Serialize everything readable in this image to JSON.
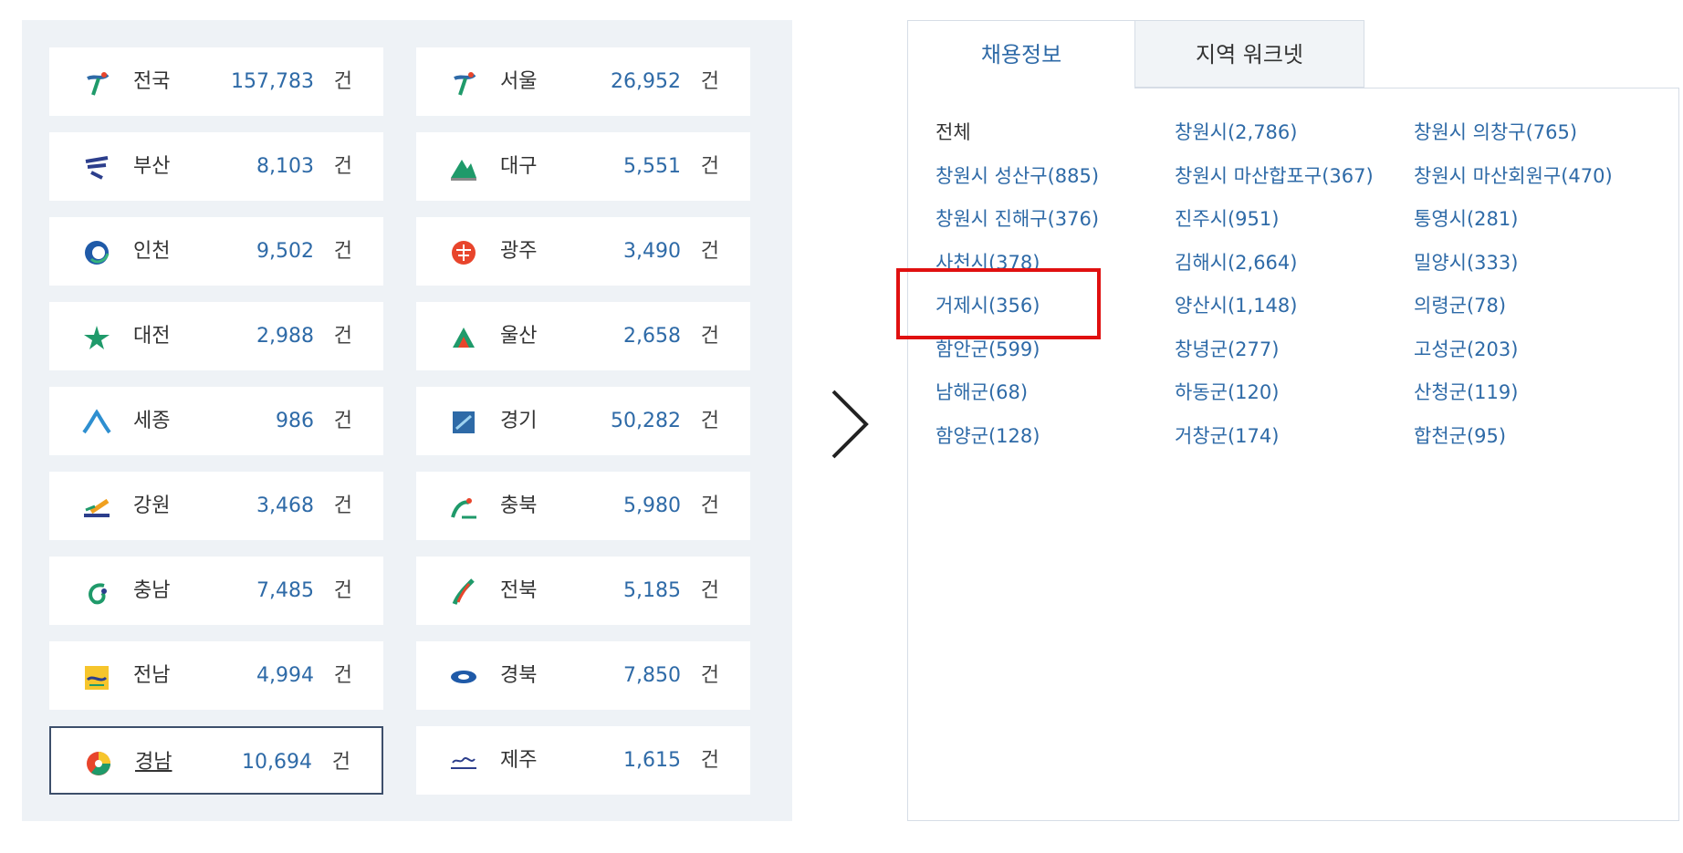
{
  "regions": [
    {
      "name": "전국",
      "count": "157,783",
      "unit": "건",
      "icon": "national-logo-icon",
      "selected": false
    },
    {
      "name": "서울",
      "count": "26,952",
      "unit": "건",
      "icon": "seoul-logo-icon",
      "selected": false
    },
    {
      "name": "부산",
      "count": "8,103",
      "unit": "건",
      "icon": "busan-logo-icon",
      "selected": false
    },
    {
      "name": "대구",
      "count": "5,551",
      "unit": "건",
      "icon": "daegu-logo-icon",
      "selected": false
    },
    {
      "name": "인천",
      "count": "9,502",
      "unit": "건",
      "icon": "incheon-logo-icon",
      "selected": false
    },
    {
      "name": "광주",
      "count": "3,490",
      "unit": "건",
      "icon": "gwangju-logo-icon",
      "selected": false
    },
    {
      "name": "대전",
      "count": "2,988",
      "unit": "건",
      "icon": "daejeon-logo-icon",
      "selected": false
    },
    {
      "name": "울산",
      "count": "2,658",
      "unit": "건",
      "icon": "ulsan-logo-icon",
      "selected": false
    },
    {
      "name": "세종",
      "count": "986",
      "unit": "건",
      "icon": "sejong-logo-icon",
      "selected": false
    },
    {
      "name": "경기",
      "count": "50,282",
      "unit": "건",
      "icon": "gyeonggi-logo-icon",
      "selected": false
    },
    {
      "name": "강원",
      "count": "3,468",
      "unit": "건",
      "icon": "gangwon-logo-icon",
      "selected": false
    },
    {
      "name": "충북",
      "count": "5,980",
      "unit": "건",
      "icon": "chungbuk-logo-icon",
      "selected": false
    },
    {
      "name": "충남",
      "count": "7,485",
      "unit": "건",
      "icon": "chungnam-logo-icon",
      "selected": false
    },
    {
      "name": "전북",
      "count": "5,185",
      "unit": "건",
      "icon": "jeonbuk-logo-icon",
      "selected": false
    },
    {
      "name": "전남",
      "count": "4,994",
      "unit": "건",
      "icon": "jeonnam-logo-icon",
      "selected": false
    },
    {
      "name": "경북",
      "count": "7,850",
      "unit": "건",
      "icon": "gyeongbuk-logo-icon",
      "selected": false
    },
    {
      "name": "경남",
      "count": "10,694",
      "unit": "건",
      "icon": "gyeongnam-logo-icon",
      "selected": true
    },
    {
      "name": "제주",
      "count": "1,615",
      "unit": "건",
      "icon": "jeju-logo-icon",
      "selected": false
    }
  ],
  "tabs": {
    "active_label": "채용정보",
    "inactive_label": "지역 워크넷"
  },
  "districts": [
    "전체",
    "창원시(2,786)",
    "창원시 의창구(765)",
    "창원시 성산구(885)",
    "창원시 마산합포구(367)",
    "창원시 마산회원구(470)",
    "창원시 진해구(376)",
    "진주시(951)",
    "통영시(281)",
    "사천시(378)",
    "김해시(2,664)",
    "밀양시(333)",
    "거제시(356)",
    "양산시(1,148)",
    "의령군(78)",
    "함안군(599)",
    "창녕군(277)",
    "고성군(203)",
    "남해군(68)",
    "하동군(120)",
    "산청군(119)",
    "함양군(128)",
    "거창군(174)",
    "합천군(95)"
  ],
  "colors": {
    "accent": "#2e6aa7",
    "panel_bg": "#eef2f6",
    "selected_border": "#3d4f6b",
    "highlight": "#e01010"
  },
  "icons": {
    "chevron": "chevron-right-icon"
  }
}
